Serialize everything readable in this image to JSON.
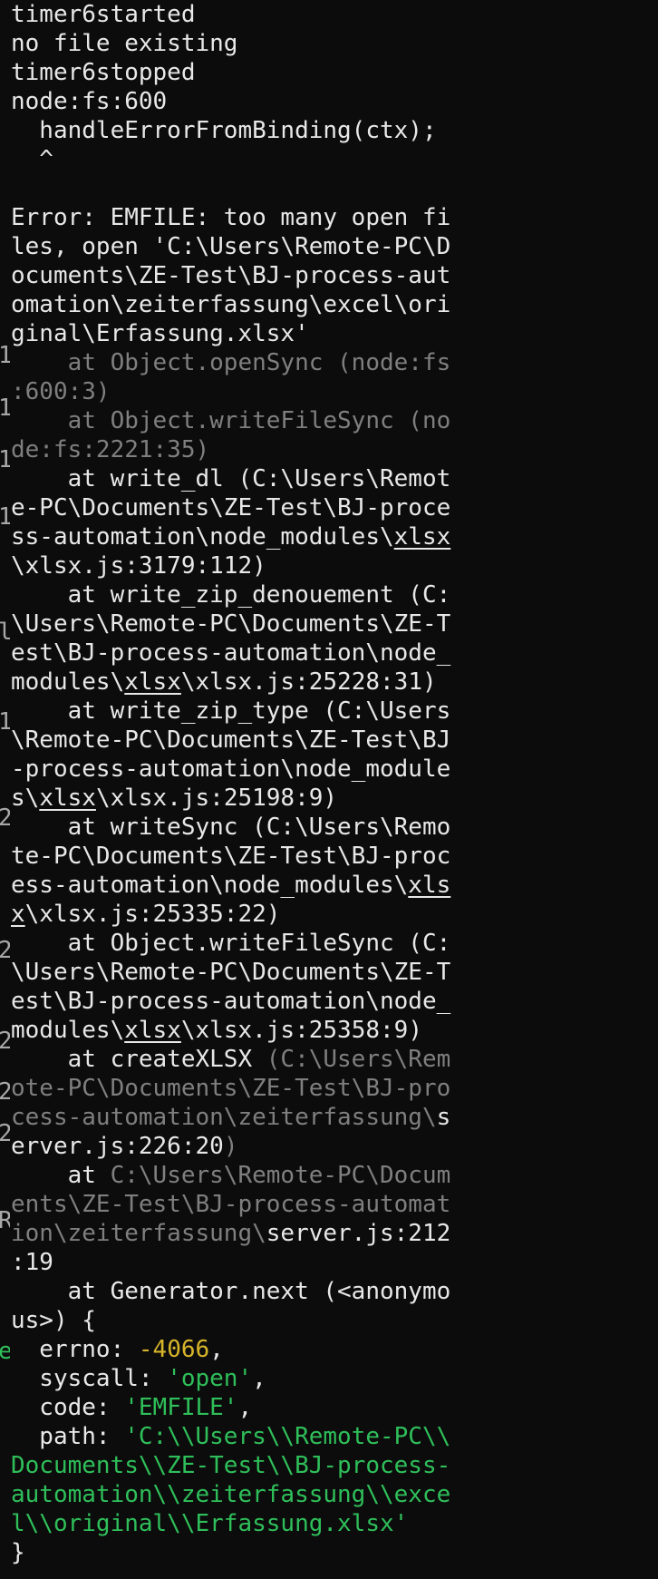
{
  "terminal": {
    "header": [
      "timer6started",
      "no file existing",
      "timer6stopped",
      "node:fs:600",
      "  handleErrorFromBinding(ctx);",
      "  ^"
    ],
    "error": [
      "Error: EMFILE: too many open fi",
      "les, open 'C:\\Users\\Remote-PC\\D",
      "ocuments\\ZE-Test\\BJ-process-aut",
      "omation\\zeiterfassung\\excel\\ori",
      "ginal\\Erfassung.xlsx'"
    ],
    "stack": {
      "open_sync": [
        "    at Object.openSync (node:fs",
        ":600:3)"
      ],
      "write_file_sync": [
        "    at Object.writeFileSync (no",
        "de:fs:2221:35)"
      ],
      "write_dl": {
        "l1": "    at write_dl (C:\\Users\\Remot",
        "l2": "e-PC\\Documents\\ZE-Test\\BJ-proce",
        "l3a": "ss-automation\\node_modules\\",
        "l3u": "xlsx",
        "l4": "\\xlsx.js:3179:112)"
      },
      "write_zip_denouement": {
        "l1": "    at write_zip_denouement (C:",
        "l2": "\\Users\\Remote-PC\\Documents\\ZE-T",
        "l3": "est\\BJ-process-automation\\node_",
        "l4a": "modules\\",
        "l4u": "xlsx",
        "l4b": "\\xlsx.js:25228:31)"
      },
      "write_zip_type": {
        "l1": "    at write_zip_type (C:\\Users",
        "l2": "\\Remote-PC\\Documents\\ZE-Test\\BJ",
        "l3": "-process-automation\\node_module",
        "l4a": "s\\",
        "l4u": "xlsx",
        "l4b": "\\xlsx.js:25198:9)"
      },
      "write_sync": {
        "l1": "    at writeSync (C:\\Users\\Remo",
        "l2": "te-PC\\Documents\\ZE-Test\\BJ-proc",
        "l3a": "ess-automation\\node_modules\\",
        "l3u": "xls",
        "l4u": "x",
        "l4b": "\\xlsx.js:25335:22)"
      },
      "object_write_file_sync": {
        "l1": "    at Object.writeFileSync (C:",
        "l2": "\\Users\\Remote-PC\\Documents\\ZE-T",
        "l3": "est\\BJ-process-automation\\node_",
        "l4a": "modules\\",
        "l4u": "xlsx",
        "l4b": "\\xlsx.js:25358:9)"
      },
      "create_xlsx": {
        "l1a": "    at createXLSX ",
        "l1b": "(C:\\Users\\Rem",
        "l2": "ote-PC\\Documents\\ZE-Test\\BJ-pro",
        "l3a": "cess-automation\\zeiterfassung\\",
        "l3b": "s",
        "l4a": "erver.js:226:20",
        "l4b": ")"
      },
      "anonymous_path": {
        "l1a": "    at ",
        "l1b": "C:\\Users\\Remote-PC\\Docum",
        "l2": "ents\\ZE-Test\\BJ-process-automat",
        "l3a": "ion\\zeiterfassung\\",
        "l3b": "server.js:212",
        "l4": ":19"
      },
      "generator_next": [
        "    at Generator.next (<anonymo",
        "us>) {"
      ]
    },
    "details": {
      "errno_key": "  errno: ",
      "errno_val": "-4066",
      "errno_end": ",",
      "syscall_key": "  syscall: ",
      "syscall_val": "'open'",
      "syscall_end": ",",
      "code_key": "  code: ",
      "code_val": "'EMFILE'",
      "code_end": ",",
      "path_key": "  path: ",
      "path_l1": "'C:\\\\Users\\\\Remote-PC\\\\",
      "path_l2": "Documents\\\\ZE-Test\\\\BJ-process-",
      "path_l3": "automation\\\\zeiterfassung\\\\exce",
      "path_l4": "l\\\\original\\\\Erfassung.xlsx'",
      "close": "}"
    },
    "colors": {
      "background": "#0c0c0c",
      "text": "#e8e8e8",
      "dim": "#7f7f7f",
      "number": "#d7b52a",
      "string": "#2fbf5a"
    }
  }
}
